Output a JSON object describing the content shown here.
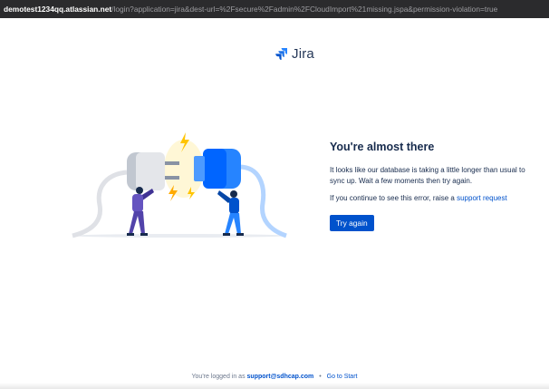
{
  "browser": {
    "url_host": "demotest1234qq.atlassian.net",
    "url_path": "/login?application=jira&dest-url=%2Fsecure%2Fadmin%2FCloudImport%21missing.jspa&permission-violation=true"
  },
  "logo": {
    "text": "Jira",
    "icon": "jira-logo-icon",
    "color": "#2684ff"
  },
  "illustration": {
    "name": "plug-connection-illustration"
  },
  "content": {
    "title": "You're almost there",
    "message": "It looks like our database is taking a little longer than usual to sync up. Wait a few moments then try again.",
    "note_prefix": "If you continue to see this error, raise a",
    "note_link": "support request",
    "button": "Try again"
  },
  "footer": {
    "prefix": "You're logged in as",
    "email": "support@sdhcap.com",
    "separator": "•",
    "go_link": "Go to Start"
  },
  "colors": {
    "accent": "#0052cc",
    "text": "#172b4d",
    "muted": "#6b778c"
  }
}
